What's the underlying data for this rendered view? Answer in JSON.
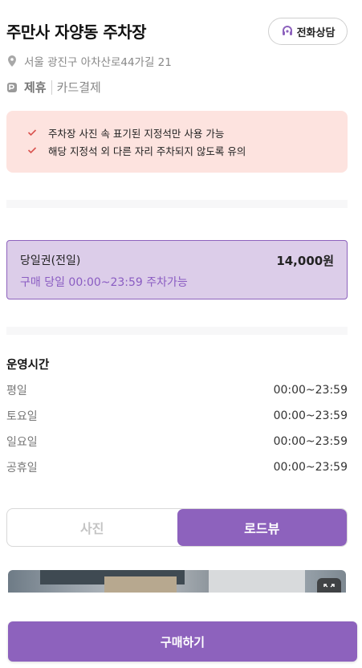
{
  "header": {
    "title": "주만사 자양동 주차장",
    "call_label": "전화상담"
  },
  "address": "서울 광진구 아차산로44가길 21",
  "tags": {
    "partner": "제휴",
    "card": "카드결제"
  },
  "notice": {
    "items": [
      "주차장 사진 속 표기된 지정석만 사용 가능",
      "해당 지정석 외 다른 자리 주차되지 않도록 유의"
    ]
  },
  "ticket": {
    "name": "당일권(전일)",
    "price": "14,000원",
    "desc": "구매 당일 00:00~23:59 주차가능"
  },
  "hours": {
    "title": "운영시간",
    "rows": [
      {
        "day": "평일",
        "time": "00:00~23:59"
      },
      {
        "day": "토요일",
        "time": "00:00~23:59"
      },
      {
        "day": "일요일",
        "time": "00:00~23:59"
      },
      {
        "day": "공휴일",
        "time": "00:00~23:59"
      }
    ]
  },
  "toggle": {
    "photo": "사진",
    "roadview": "로드뷰",
    "selected": "로드뷰"
  },
  "buy_label": "구매하기",
  "colors": {
    "accent": "#8d62bd",
    "notice_bg": "#fde3df",
    "ticket_bg": "#dccde9",
    "check": "#d9534f"
  },
  "icons": {
    "call": "headset-icon",
    "address": "map-pin-icon",
    "partner": "parking-tag-icon",
    "check": "check-icon",
    "expand": "expand-icon"
  }
}
